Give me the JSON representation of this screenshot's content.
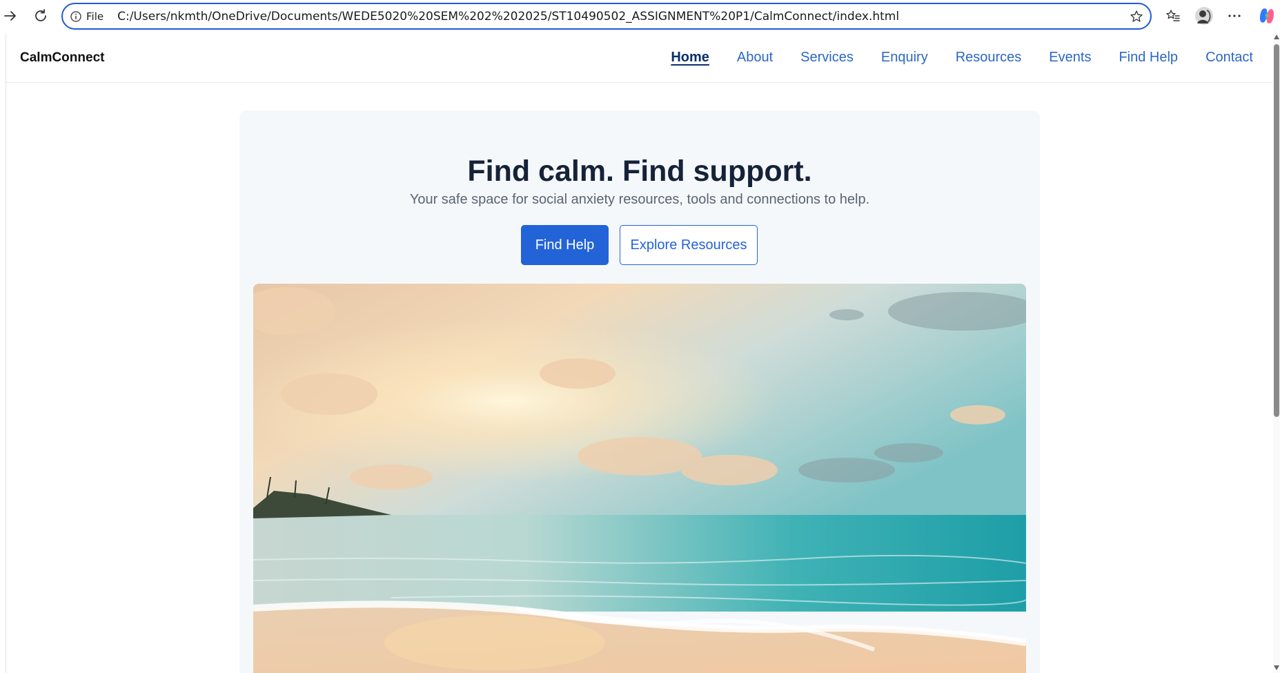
{
  "browser": {
    "address_scheme_label": "File",
    "url": "C:/Users/nkmth/OneDrive/Documents/WEDE5020%20SEM%202%202025/ST10490502_ASSIGNMENT%20P1/CalmConnect/index.html",
    "accent_color": "#1f5bd6"
  },
  "site": {
    "brand": "CalmConnect",
    "nav": [
      {
        "label": "Home",
        "active": true
      },
      {
        "label": "About"
      },
      {
        "label": "Services"
      },
      {
        "label": "Enquiry"
      },
      {
        "label": "Resources"
      },
      {
        "label": "Events"
      },
      {
        "label": "Find Help"
      },
      {
        "label": "Contact"
      }
    ],
    "link_color": "#2b67c4"
  },
  "hero": {
    "title": "Find calm. Find support.",
    "subtitle": "Your safe space for social anxiety resources, tools and connections to help.",
    "primary_button": "Find Help",
    "secondary_button": "Explore Resources",
    "primary_color": "#2363d8",
    "image": "beach-sunset-image"
  }
}
